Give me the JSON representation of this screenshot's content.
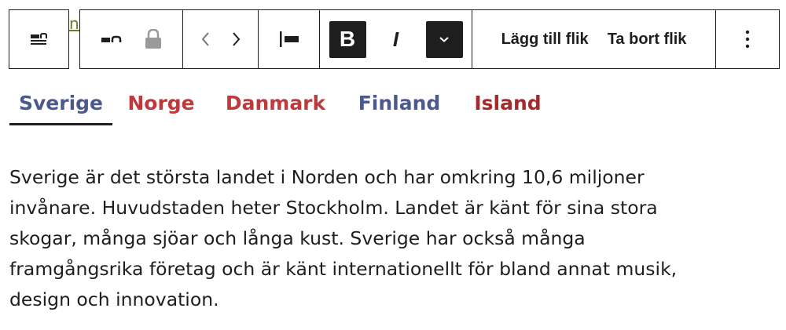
{
  "toolbar": {
    "block_switcher_icon": "text-block-icon",
    "hidden_text_fragment": "nt",
    "group_icon": "group-block-icon",
    "lock_icon": "lock-icon",
    "prev_icon": "chevron-left-icon",
    "next_icon": "chevron-right-icon",
    "align_icon": "align-left-icon",
    "bold_label": "B",
    "italic_label": "I",
    "more_formatting_icon": "chevron-down-icon",
    "add_tab_label": "Lägg till flik",
    "remove_tab_label": "Ta bort flik",
    "options_icon": "more-vertical-icon"
  },
  "tabs": [
    {
      "label": "Sverige",
      "color": "#4a5a8f",
      "active": true
    },
    {
      "label": "Norge",
      "color": "#c0383a",
      "active": false
    },
    {
      "label": "Danmark",
      "color": "#bf3a3c",
      "active": false
    },
    {
      "label": "Finland",
      "color": "#4a5a8f",
      "active": false
    },
    {
      "label": "Island",
      "color": "#a52a2e",
      "active": false
    }
  ],
  "content": {
    "line1": "Sverige är det största landet i Norden och har omkring 10,6 miljoner",
    "line2": "invånare. Huvudstaden heter Stockholm. Landet är känt för sina stora",
    "line3": "skogar, många sjöar och långa kust. Sverige har också många",
    "line4": "framgångsrika företag och är känt internationellt för bland annat musik,",
    "line5": "design och innovation."
  }
}
